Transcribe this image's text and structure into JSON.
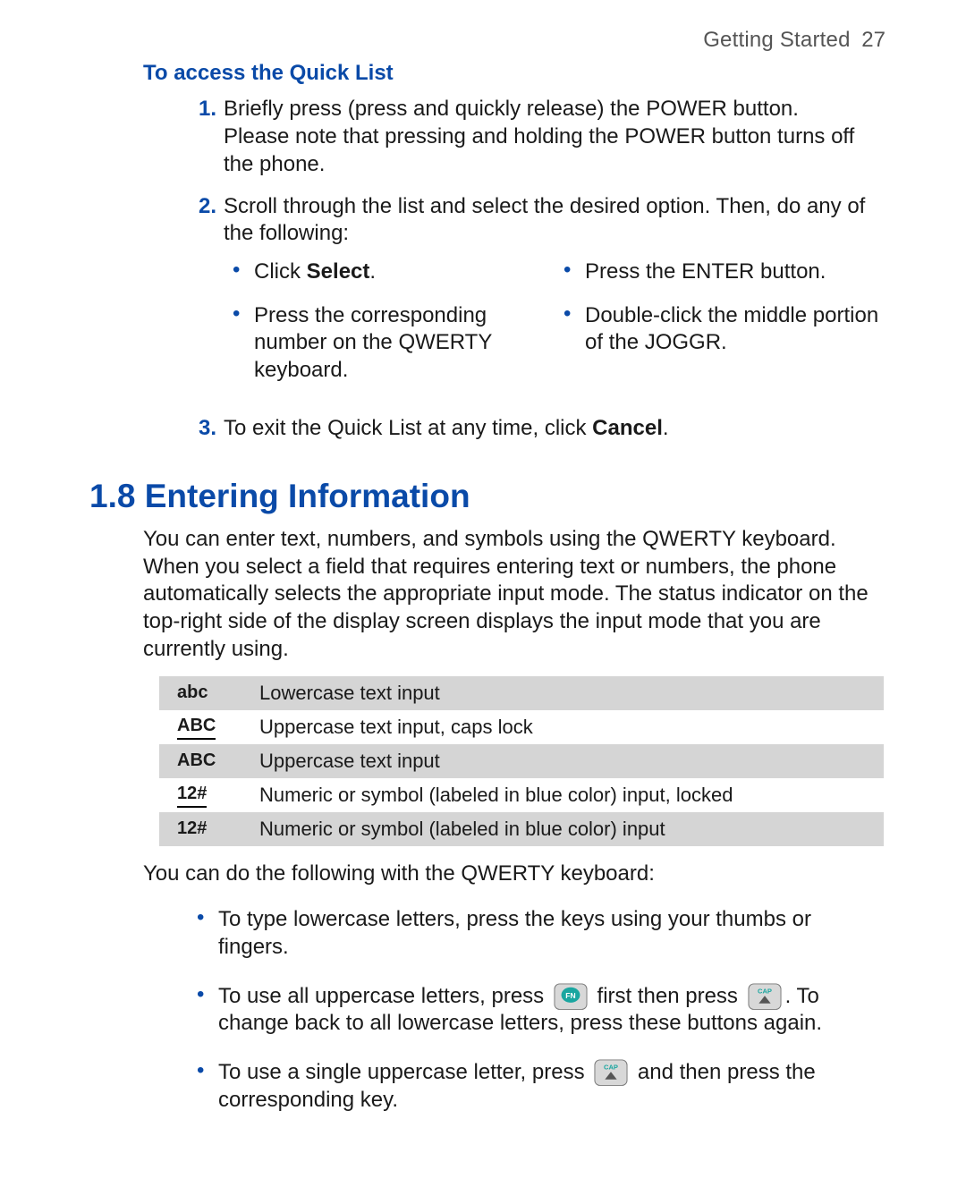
{
  "header": {
    "chapter": "Getting Started",
    "page": "27"
  },
  "quicklist": {
    "heading": "To access the Quick List",
    "steps": {
      "s1": {
        "num": "1.",
        "text_a": "Briefly press (press and quickly release) the POWER button.",
        "text_b": "Please note that pressing and holding the POWER button turns off the phone."
      },
      "s2": {
        "num": "2.",
        "text": "Scroll through the list and select the desired option. Then, do any of the following:",
        "opts": {
          "a_pre": "Click ",
          "a_bold": "Select",
          "a_post": ".",
          "b": "Press the ENTER button.",
          "c": "Press the corresponding number on the QWERTY keyboard.",
          "d": "Double-click the middle portion of the JOGGR."
        }
      },
      "s3": {
        "num": "3.",
        "text_pre": "To exit the Quick List at any time, click ",
        "text_bold": "Cancel",
        "text_post": "."
      }
    }
  },
  "section": {
    "number": "1.8",
    "title": "Entering Information",
    "intro": "You can enter text, numbers, and symbols using the QWERTY keyboard. When you select a field that requires entering text or numbers, the phone automatically selects the appropriate input mode. The status indicator on the top-right side of the display screen displays the input mode that you are currently using."
  },
  "modes": {
    "r1": {
      "ind": "abc",
      "desc": "Lowercase text input"
    },
    "r2": {
      "ind": "ABC",
      "desc": "Uppercase text input, caps lock"
    },
    "r3": {
      "ind": "ABC",
      "desc": "Uppercase text input"
    },
    "r4": {
      "ind": "12#",
      "desc": "Numeric or symbol (labeled in blue color) input, locked"
    },
    "r5": {
      "ind": "12#",
      "desc": "Numeric or symbol (labeled in blue color) input"
    }
  },
  "kb_intro": "You can do the following with the QWERTY keyboard:",
  "kb": {
    "i1": "To type lowercase letters, press the keys using your thumbs or fingers.",
    "i2_a": "To use all uppercase letters, press ",
    "i2_b": " first then press ",
    "i2_c": ". To change back to all lowercase letters, press these buttons again.",
    "i3_a": "To use a single uppercase letter, press ",
    "i3_b": " and then press the corresponding key."
  },
  "icons": {
    "fn": "FN",
    "cap": "CAP"
  }
}
